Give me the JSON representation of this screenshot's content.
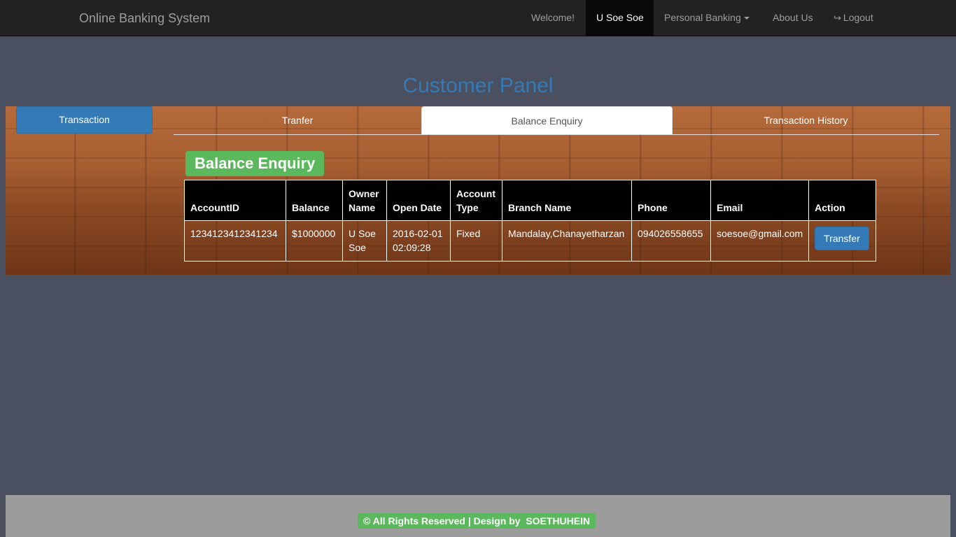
{
  "navbar": {
    "brand": "Online Banking System",
    "welcome": "Welcome!",
    "user": "U Soe Soe",
    "personal_banking": "Personal Banking",
    "about_us": "About Us",
    "logout": "Logout"
  },
  "page_title": "Customer Panel",
  "sidebar": {
    "transaction_label": "Transaction"
  },
  "tabs": {
    "transfer": "Tranfer",
    "balance_enquiry": "Balance Enquiry",
    "transaction_history": "Transaction History"
  },
  "section_title": "Balance Enquiry",
  "table": {
    "headers": {
      "account_id": "AccountID",
      "balance": "Balance",
      "owner_name_1": "Owner",
      "owner_name_2": "Name",
      "open_date": "Open Date",
      "account_type_1": "Account",
      "account_type_2": "Type",
      "branch_name": "Branch Name",
      "phone": "Phone",
      "email": "Email",
      "action": "Action"
    },
    "row": {
      "account_id": "1234123412341234",
      "balance": "$1000000",
      "owner_name_1": "U Soe",
      "owner_name_2": "Soe",
      "open_date_1": "2016-02-01",
      "open_date_2": "02:09:28",
      "account_type": "Fixed",
      "branch_name": "Mandalay,Chanayetharzan",
      "phone": "094026558655",
      "email": "soesoe@gmail.com",
      "action_label": "Transfer"
    }
  },
  "footer": {
    "text": "© All Rights Reserved | Design by  SOETHUHEIN"
  },
  "colors": {
    "navbar": "#222222",
    "primary": "#337ab7",
    "success": "#5cb85c",
    "background": "#4a5060",
    "footer": "#9c9c9c"
  }
}
